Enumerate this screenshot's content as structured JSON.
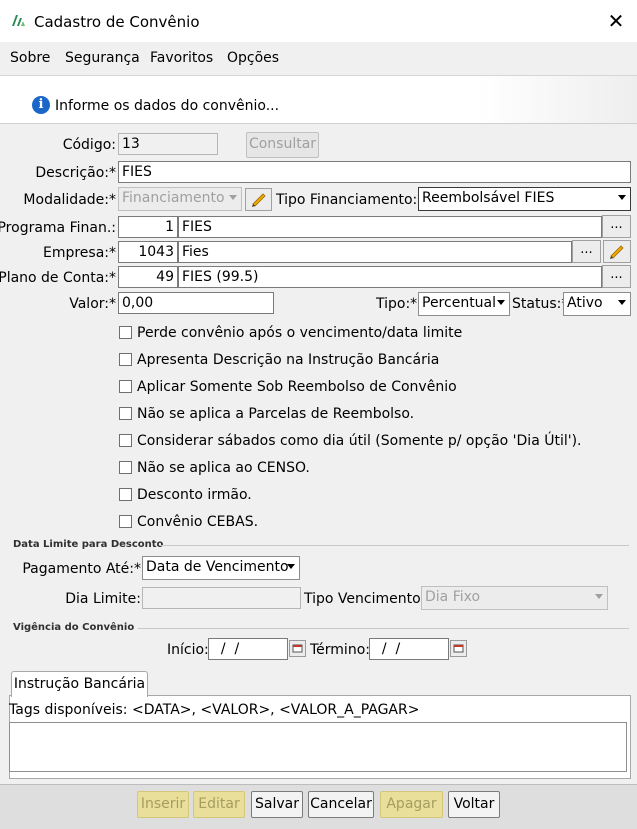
{
  "window": {
    "title": "Cadastro de Convênio",
    "close": "✕"
  },
  "menu": {
    "items": [
      "Sobre",
      "Segurança",
      "Favoritos",
      "Opções"
    ]
  },
  "banner": {
    "text": "Informe os dados do convênio..."
  },
  "form": {
    "codigo": {
      "label": "Código:",
      "value": "13",
      "consultar": "Consultar"
    },
    "descricao": {
      "label": "Descrição:*",
      "value": "FIES"
    },
    "modalidade": {
      "label": "Modalidade:*",
      "value": "Financiamento"
    },
    "tipo_financiamento": {
      "label": "Tipo Financiamento:*",
      "value": "Reembolsável FIES"
    },
    "programa": {
      "label": "Programa Finan.:",
      "code": "1",
      "name": "FIES",
      "dots": "..."
    },
    "empresa": {
      "label": "Empresa:*",
      "code": "1043",
      "name": "Fies",
      "dots": "..."
    },
    "plano_conta": {
      "label": "Plano de Conta:*",
      "code": "49",
      "name": "FIES (99.5)",
      "dots": "..."
    },
    "valor": {
      "label": "Valor:*",
      "value": "0,00"
    },
    "tipo": {
      "label": "Tipo:*",
      "value": "Percentual"
    },
    "status": {
      "label": "Status:*",
      "value": "Ativo"
    }
  },
  "checkboxes": [
    "Perde convênio após o vencimento/data limite",
    "Apresenta Descrição na Instrução Bancária",
    "Aplicar Somente Sob Reembolso de Convênio",
    "Não se aplica a Parcelas de Reembolso.",
    "Considerar sábados como dia útil (Somente p/ opção 'Dia Útil').",
    "Não se aplica ao CENSO.",
    "Desconto irmão.",
    "Convênio CEBAS."
  ],
  "data_limite": {
    "section": "Data Limite para Desconto",
    "pagamento_label": "Pagamento Até:*",
    "pagamento_value": "Data de Vencimento",
    "dia_limite_label": "Dia Limite:",
    "dia_limite_value": "",
    "tipo_venc_label": "Tipo Vencimento:",
    "tipo_venc_value": "Dia Fixo"
  },
  "vigencia": {
    "section": "Vigência do Convênio",
    "inicio_label": "Início:",
    "inicio_value": "  /  /",
    "termino_label": "Término:",
    "termino_value": "  /  /"
  },
  "instrucao": {
    "tab": "Instrução Bancária",
    "tags": "Tags disponíveis: <DATA>, <VALOR>, <VALOR_A_PAGAR>",
    "text": ""
  },
  "actions": {
    "inserir": "Inserir",
    "editar": "Editar",
    "salvar": "Salvar",
    "cancelar": "Cancelar",
    "apagar": "Apagar",
    "voltar": "Voltar"
  },
  "colors": {
    "info_blue": "#1b66c9",
    "logo_green": "#2e8b57",
    "disabled_button": "#e9df9a"
  }
}
